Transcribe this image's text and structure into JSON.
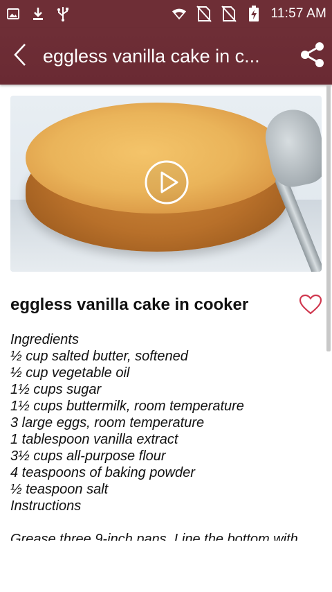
{
  "status_bar": {
    "time": "11:57 AM",
    "icons": [
      "image-icon",
      "download-icon",
      "usb-icon",
      "wifi-icon",
      "no-sim-icon",
      "no-sim-icon",
      "battery-charging-icon"
    ]
  },
  "app_bar": {
    "title": "eggless vanilla cake in c...",
    "back_icon": "back-arrow-icon",
    "share_icon": "share-icon"
  },
  "recipe": {
    "title": "eggless vanilla cake in cooker",
    "image_alt_icon": "play-icon",
    "favorite_icon": "heart-outline-icon",
    "lines": [
      "Ingredients",
      "½ cup salted butter, softened",
      "½ cup vegetable oil",
      "1½ cups sugar",
      "1½ cups buttermilk, room temperature",
      "3 large eggs, room temperature",
      "1 tablespoon vanilla extract",
      "3½ cups all-purpose flour",
      "4 teaspoons of baking powder",
      "½ teaspoon salt",
      "Instructions"
    ],
    "cut_line": "Grease three 9-inch pans. Line the bottom with"
  },
  "colors": {
    "primary": "#6e2e36",
    "accent_heart": "#d0384f"
  }
}
